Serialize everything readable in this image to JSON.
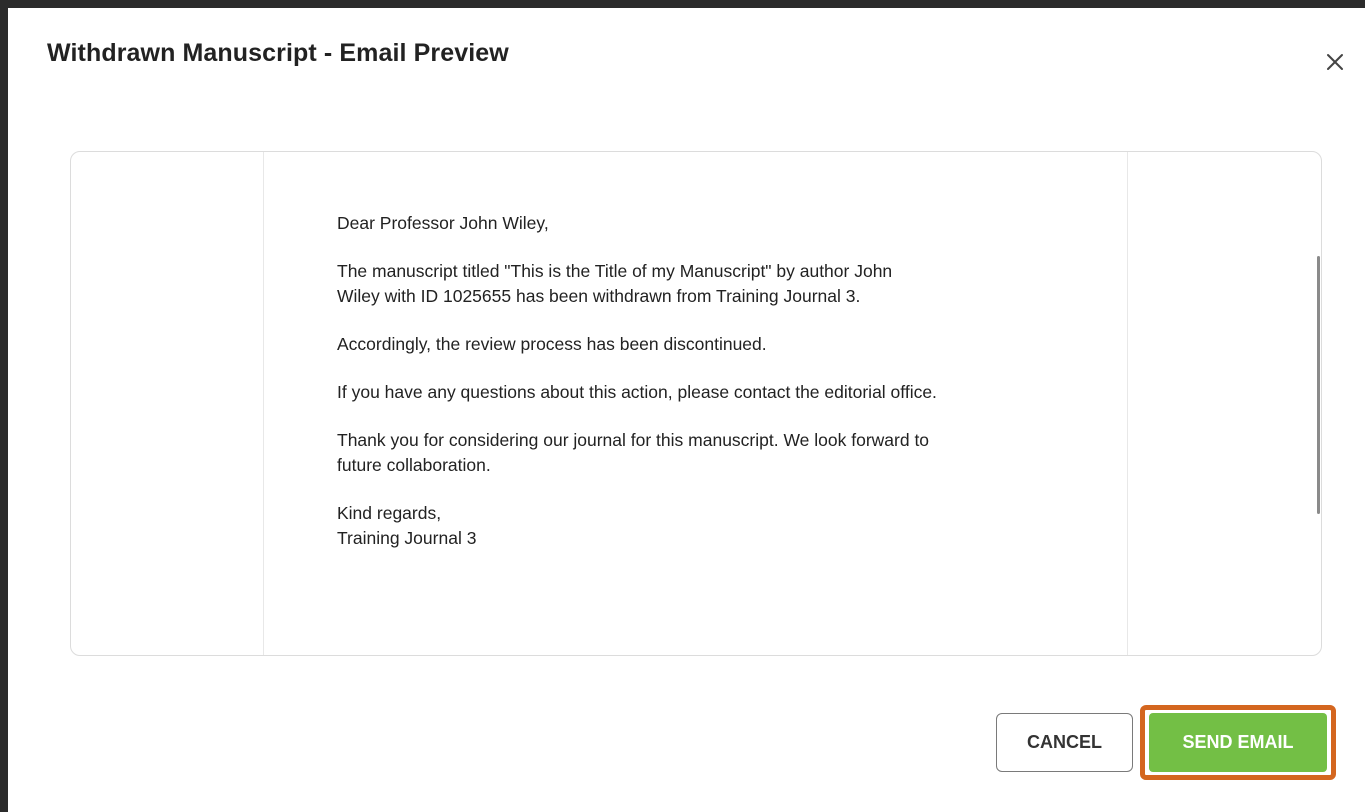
{
  "modal": {
    "title": "Withdrawn Manuscript - Email Preview",
    "close_icon": "close-icon"
  },
  "email": {
    "greeting": "Dear Professor John Wiley,",
    "paragraph_1": "The manuscript titled \"This is the Title of my Manuscript\" by author John\nWiley with ID 1025655 has been withdrawn from Training Journal 3.",
    "paragraph_2": "Accordingly, the review process has been discontinued.",
    "paragraph_3": "If you have any questions about this action, please contact the editorial office.",
    "paragraph_4": "Thank you for considering our journal for this manuscript. We look forward to\nfuture collaboration.",
    "closing": "Kind regards,",
    "signature": "Training Journal 3"
  },
  "actions": {
    "cancel_label": "CANCEL",
    "send_label": "SEND EMAIL"
  },
  "colors": {
    "send_button": "#73bf45",
    "highlight": "#d4661f"
  }
}
